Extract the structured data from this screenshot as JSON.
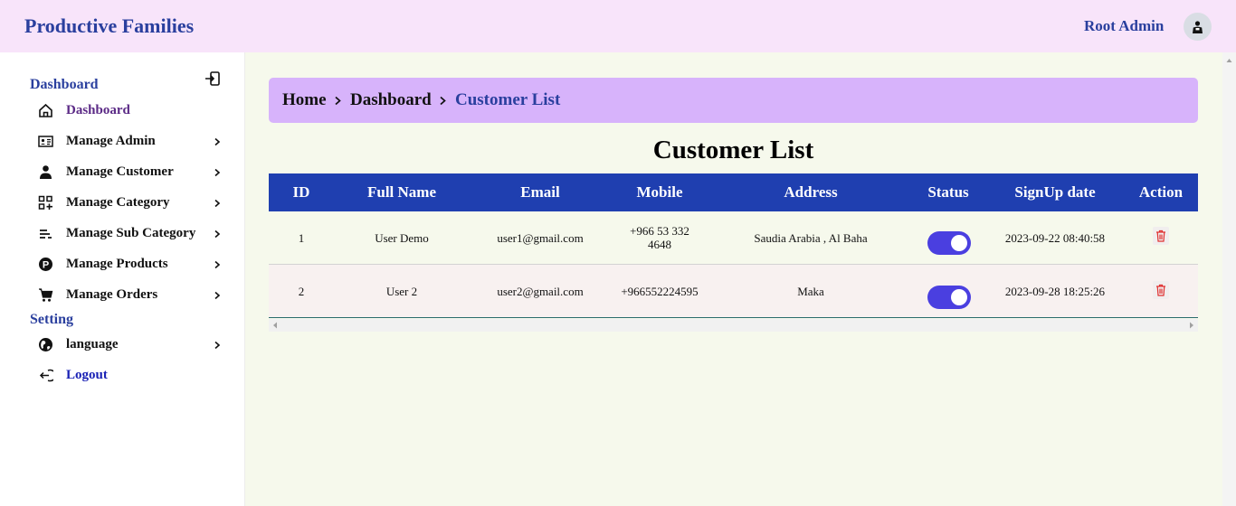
{
  "header": {
    "brand": "Productive Families",
    "user_name": "Root Admin"
  },
  "sidebar": {
    "section_dashboard": "Dashboard",
    "section_setting": "Setting",
    "items": [
      {
        "label": "Dashboard",
        "icon": "home-icon"
      },
      {
        "label": "Manage Admin",
        "icon": "id-card-icon"
      },
      {
        "label": "Manage Customer",
        "icon": "person-icon"
      },
      {
        "label": "Manage Category",
        "icon": "grid-plus-icon"
      },
      {
        "label": "Manage Sub Category",
        "icon": "list-lines-icon"
      },
      {
        "label": "Manage Products",
        "icon": "product-p-icon"
      },
      {
        "label": "Manage Orders",
        "icon": "cart-icon"
      }
    ],
    "settings": [
      {
        "label": "language",
        "icon": "globe-icon"
      },
      {
        "label": "Logout",
        "icon": "logout-icon"
      }
    ]
  },
  "breadcrumb": {
    "home": "Home",
    "dashboard": "Dashboard",
    "current": "Customer List"
  },
  "page": {
    "title": "Customer List"
  },
  "table": {
    "columns": [
      "ID",
      "Full Name",
      "Email",
      "Mobile",
      "Address",
      "Status",
      "SignUp date",
      "Action"
    ],
    "rows": [
      {
        "id": "1",
        "full_name": "User Demo",
        "email": "user1@gmail.com",
        "mobile_line1": "+966 53 332",
        "mobile_line2": "4648",
        "address": "Saudia Arabia , Al Baha",
        "status": "on",
        "signup": "2023-09-22 08:40:58"
      },
      {
        "id": "2",
        "full_name": "User 2",
        "email": "user2@gmail.com",
        "mobile_line1": "+966552224595",
        "mobile_line2": "",
        "address": "Maka",
        "status": "on",
        "signup": "2023-09-28 18:25:26"
      }
    ]
  },
  "colors": {
    "header_bg": "#f8e4fa",
    "brand": "#2a3f9e",
    "breadcrumb_bg": "#d7b3fb",
    "table_head_bg": "#1f3fb0",
    "toggle_on": "#4a3fe0",
    "delete_icon": "#e03030"
  }
}
